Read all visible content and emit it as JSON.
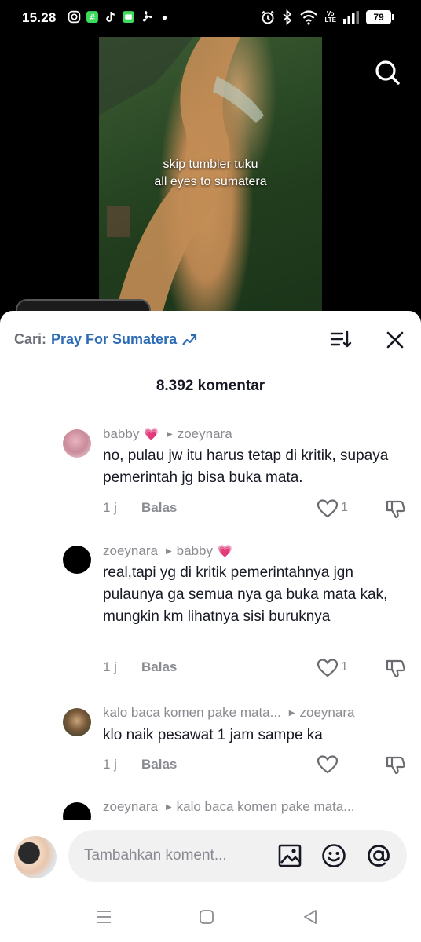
{
  "status_bar": {
    "time": "15.28",
    "battery": "79",
    "network": "Vo\nLTE"
  },
  "video": {
    "caption_line1": "skip tumbler tuku",
    "caption_line2": "all eyes to sumatera"
  },
  "sheet": {
    "search_prefix": "Cari:",
    "search_query": "Pray For Sumatera",
    "comment_count": "8.392 komentar"
  },
  "comments": [
    {
      "author": "babby",
      "author_emoji": "💗",
      "reply_to": "zoeynara",
      "reply_to_emoji": "",
      "text": "no, pulau jw itu harus tetap di kritik, supaya pemerintah jg bisa buka mata.",
      "time": "1 j",
      "reply_label": "Balas",
      "likes": "1"
    },
    {
      "author": "zoeynara",
      "author_emoji": "",
      "reply_to": "babby",
      "reply_to_emoji": "💗",
      "text": "real,tapi yg di kritik pemerintahnya jgn pulaunya ga semua nya ga buka mata kak, mungkin km lihatnya sisi buruknya",
      "time": "1 j",
      "reply_label": "Balas",
      "likes": "1"
    },
    {
      "author": "kalo baca komen pake mata...",
      "author_emoji": "",
      "reply_to": "zoeynara",
      "reply_to_emoji": "",
      "text": "klo naik pesawat 1 jam sampe ka",
      "time": "1 j",
      "reply_label": "Balas",
      "likes": ""
    },
    {
      "author": "zoeynara",
      "author_emoji": "",
      "reply_to": "kalo baca komen pake mata...",
      "reply_to_emoji": "",
      "text": "",
      "time": "",
      "reply_label": "",
      "likes": ""
    }
  ],
  "input": {
    "placeholder": "Tambahkan koment..."
  },
  "icons": {
    "search": "search-icon",
    "trend": "trending-arrow-icon",
    "sort": "sort-icon",
    "close": "close-icon",
    "like": "heart-outline-icon",
    "dislike": "thumbs-down-icon",
    "image": "image-icon",
    "emoji": "emoji-icon",
    "mention": "at-sign-icon"
  },
  "colors": {
    "link_blue": "#2d6cb4",
    "muted": "#8a8b91",
    "text": "#161823"
  }
}
